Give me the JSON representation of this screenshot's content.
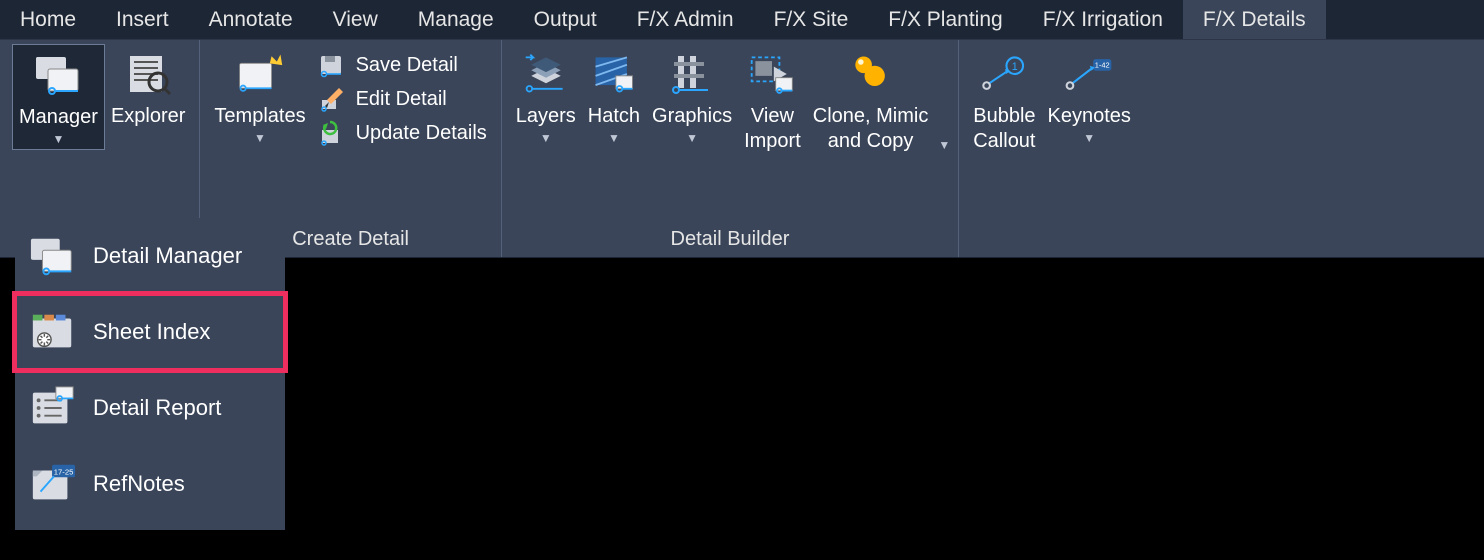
{
  "tabs": {
    "home": "Home",
    "insert": "Insert",
    "annotate": "Annotate",
    "view": "View",
    "manage": "Manage",
    "output": "Output",
    "fx_admin": "F/X Admin",
    "fx_site": "F/X Site",
    "fx_planting": "F/X Planting",
    "fx_irrigation": "F/X Irrigation",
    "fx_details": "F/X Details"
  },
  "ribbon": {
    "panel1_label": "",
    "manager_label": "Manager",
    "explorer_label": "Explorer",
    "templates_label": "Templates",
    "save_detail": "Save Detail",
    "edit_detail": "Edit Detail",
    "update_details": "Update Details",
    "create_detail_panel": "Create Detail",
    "layers": "Layers",
    "hatch": "Hatch",
    "graphics": "Graphics",
    "view_import_l1": "View",
    "view_import_l2": "Import",
    "clone_l1": "Clone, Mimic",
    "clone_l2": "and Copy",
    "detail_builder_panel": "Detail Builder",
    "bubble_l1": "Bubble",
    "bubble_l2": "Callout",
    "keynotes": "Keynotes"
  },
  "dropdown": {
    "detail_manager": "Detail Manager",
    "sheet_index": "Sheet Index",
    "detail_report": "Detail Report",
    "refnotes": "RefNotes"
  }
}
